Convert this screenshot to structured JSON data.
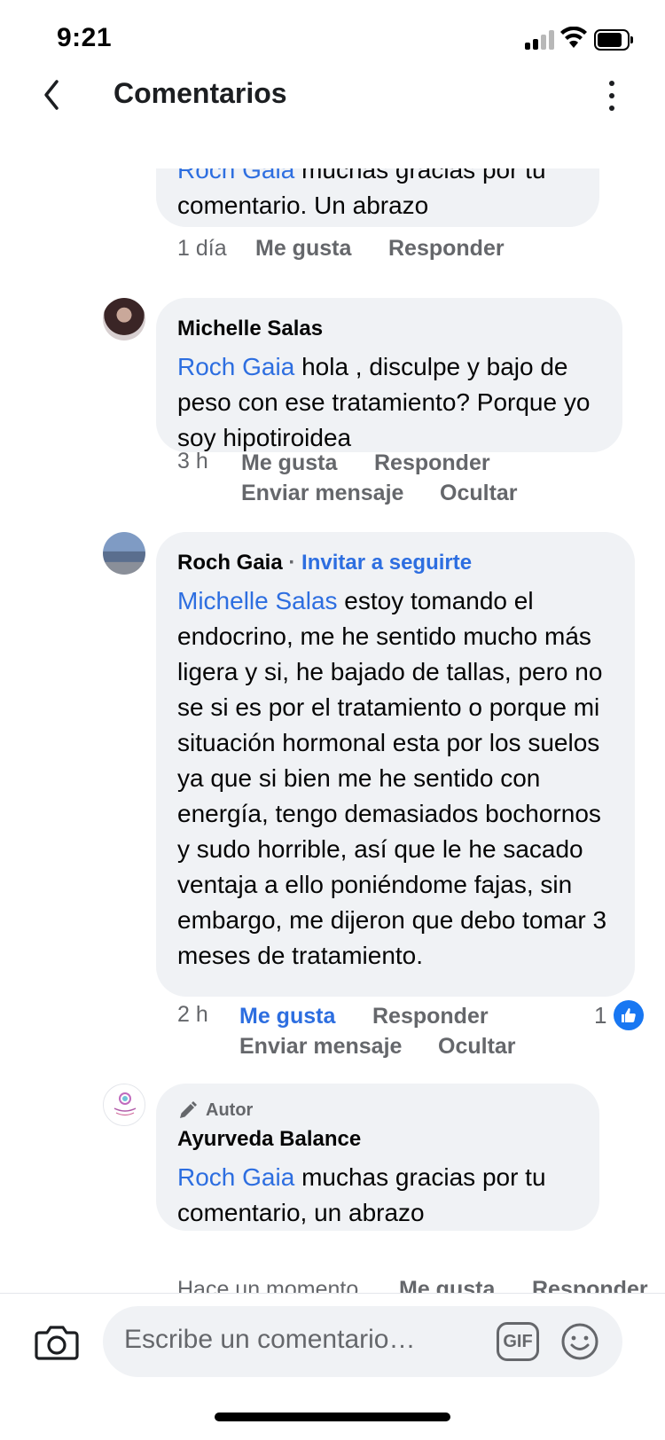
{
  "status_bar": {
    "time": "9:21"
  },
  "header": {
    "title": "Comentarios"
  },
  "comments": [
    {
      "mention": "Roch Gaia",
      "text": " muchas gracias por tu comentario. Un abrazo",
      "time": "1 día",
      "like_label": "Me gusta",
      "reply_label": "Responder"
    },
    {
      "author": "Michelle Salas",
      "mention": "Roch Gaia",
      "text": " hola , disculpe y bajo de peso con ese tratamiento? Porque yo soy hipotiroidea",
      "time": "3 h",
      "like_label": "Me gusta",
      "reply_label": "Responder",
      "message_label": "Enviar mensaje",
      "hide_label": "Ocultar"
    },
    {
      "author": "Roch Gaia",
      "separator": " · ",
      "follow_label": "Invitar a seguirte",
      "mention": "Michelle Salas",
      "text": " estoy tomando el endocrino, me he sentido mucho más ligera y si, he bajado de tallas, pero no se si es por el tratamiento o porque mi situación hormonal esta por los suelos ya que si bien me he sentido con energía, tengo demasiados bochornos y sudo horrible,  así que le he sacado ventaja a ello poniéndome fajas, sin embargo,  me dijeron que debo tomar 3 meses de tratamiento.",
      "time": "2 h",
      "like_label": "Me gusta",
      "reply_label": "Responder",
      "message_label": "Enviar mensaje",
      "hide_label": "Ocultar",
      "reaction_count": "1",
      "liked": true
    },
    {
      "badge": "Autor",
      "author": "Ayurveda Balance",
      "mention": "Roch Gaia",
      "text": " muchas gracias por tu comentario, un abrazo",
      "time_partial": "Hace un momento",
      "like_label": "Me gusta",
      "reply_label": "Responder"
    }
  ],
  "composer": {
    "placeholder": "Escribe un comentario…",
    "gif_label": "GIF"
  },
  "colors": {
    "accent": "#2d6ee0",
    "bubble": "#f0f2f5",
    "secondary_text": "#65676b",
    "like_badge": "#1877f2"
  },
  "icons": [
    "back-chevron-icon",
    "more-vertical-icon",
    "camera-icon",
    "gif-icon",
    "emoji-icon",
    "thumbs-up-icon",
    "pencil-icon"
  ]
}
